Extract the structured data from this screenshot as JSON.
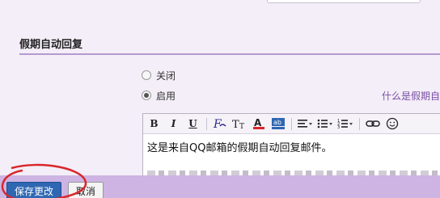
{
  "section": {
    "title": "假期自动回复"
  },
  "auto_reply": {
    "options": [
      {
        "label": "关闭",
        "selected": false
      },
      {
        "label": "启用",
        "selected": true
      }
    ],
    "help_link": "什么是假期自"
  },
  "editor": {
    "toolbar": {
      "bold": "B",
      "italic": "I",
      "underline": "U",
      "font_family_icon": "font-family-icon",
      "font_size_icon": "font-size-icon",
      "text_color_icon": "text-color-icon",
      "bg_color_icon": "highlight-icon",
      "align_icon": "align-left-icon",
      "bullet_list_icon": "bullet-list-icon",
      "numbered_list_icon": "numbered-list-icon",
      "link_icon": "link-icon",
      "emoji_icon": "emoji-icon"
    },
    "content": "这是来自QQ邮箱的假期自动回复邮件。"
  },
  "actions": {
    "save_label": "保存更改",
    "cancel_label": "取消"
  },
  "colors": {
    "footer_bg": "#cdb4e3",
    "save_bg": "#2f67b3",
    "accent_line": "#b69ad0",
    "annotation": "#d9262b"
  }
}
